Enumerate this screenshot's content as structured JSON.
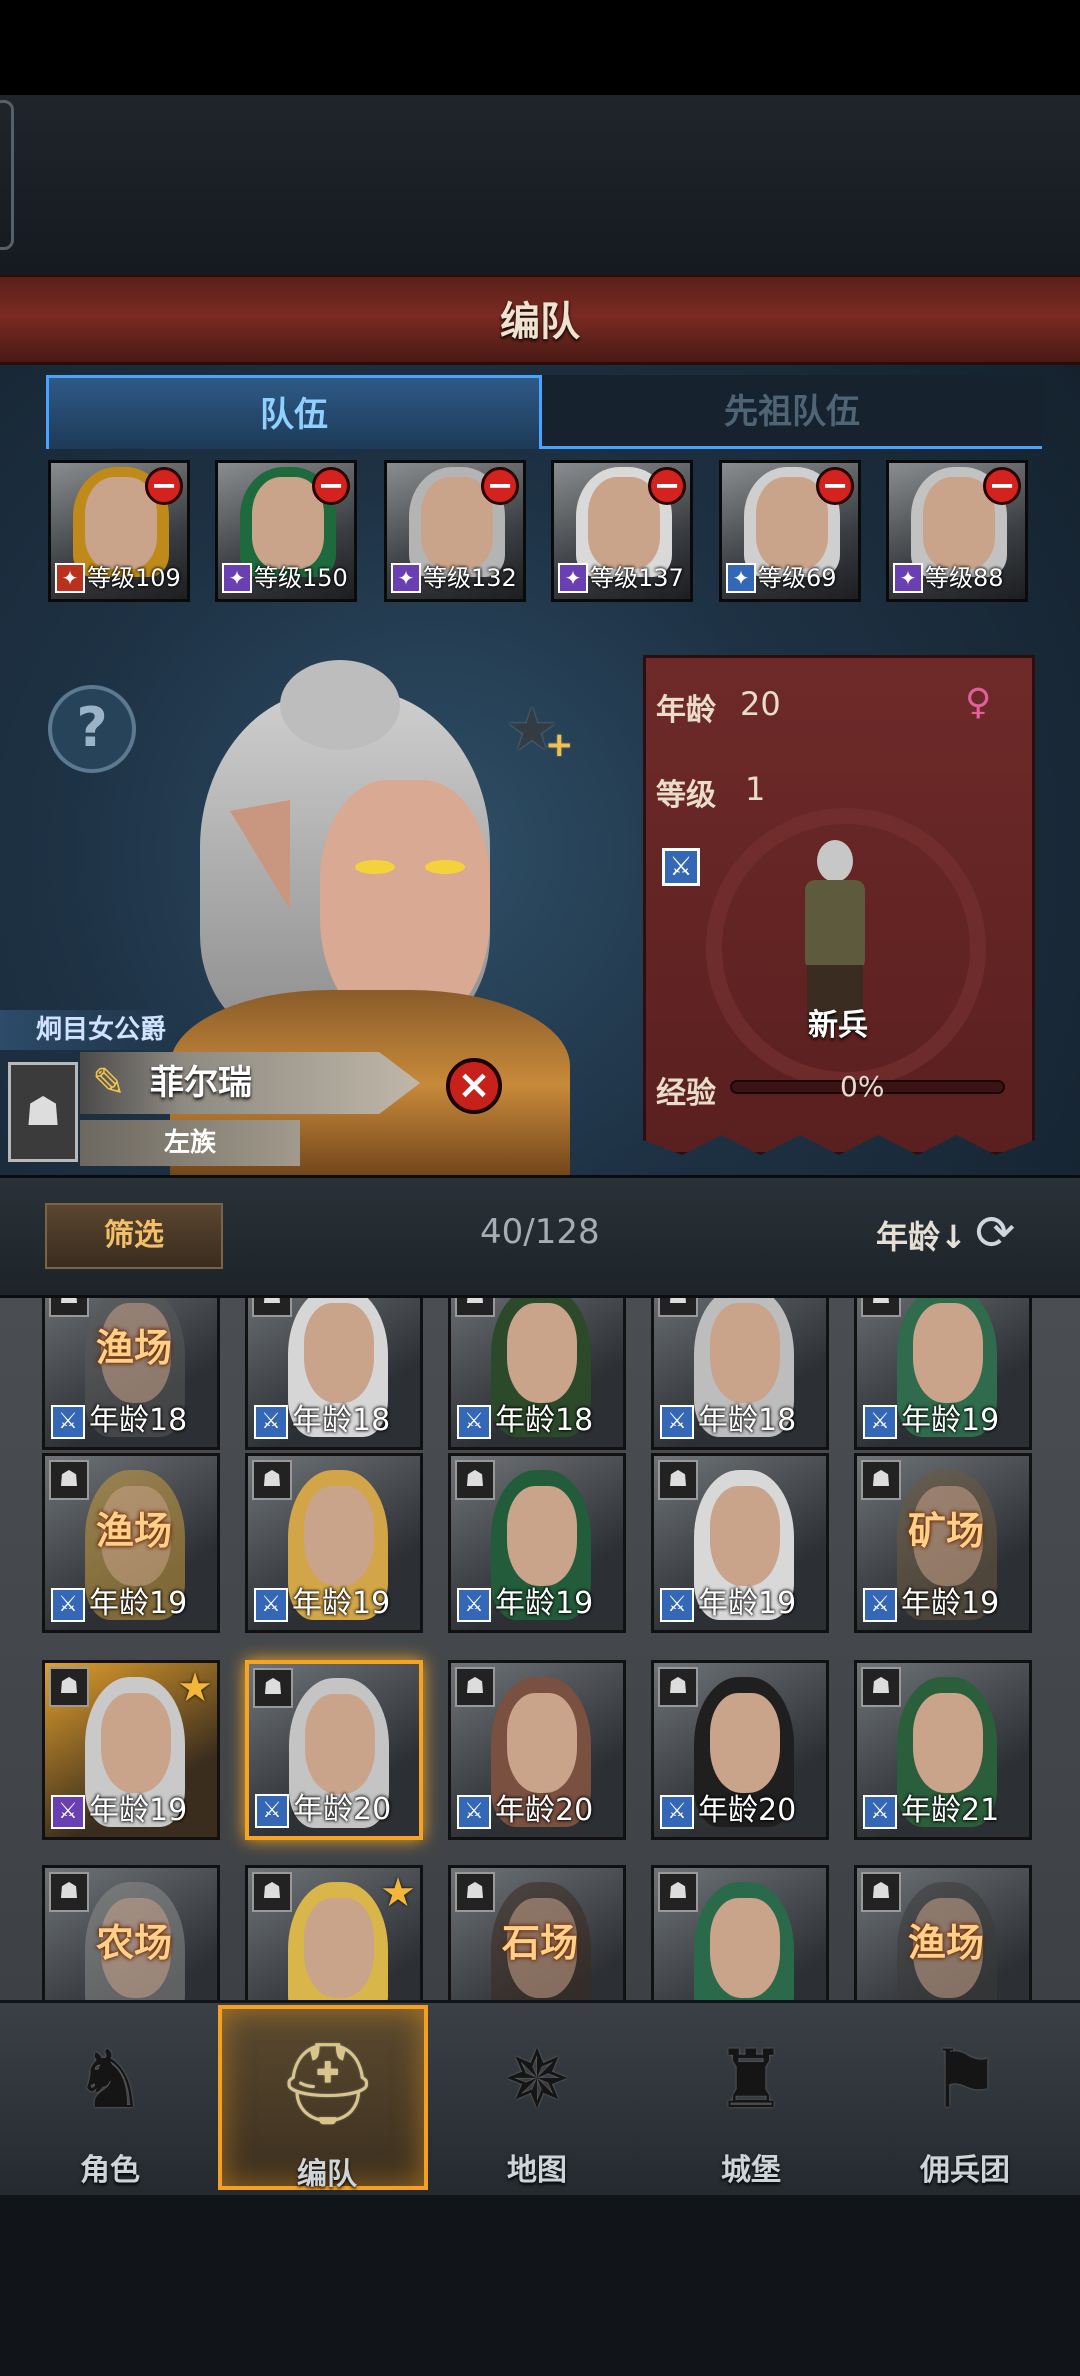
{
  "title": "编队",
  "tabs": {
    "team": "队伍",
    "ancestor": "先祖队伍"
  },
  "team_slots": [
    {
      "level": "等级109",
      "hair": "#c08a1a",
      "cls_color": "#b8321e"
    },
    {
      "level": "等级150",
      "hair": "#1f6a3c",
      "cls_color": "#6a3fb2"
    },
    {
      "level": "等级132",
      "hair": "#b4b4b4",
      "cls_color": "#6a3fb2"
    },
    {
      "level": "等级137",
      "hair": "#d9d9d9",
      "cls_color": "#6a3fb2"
    },
    {
      "level": "等级69",
      "hair": "#cfcfcf",
      "cls_color": "#3567b7"
    },
    {
      "level": "等级88",
      "hair": "#c2c2c2",
      "cls_color": "#6a3fb2"
    }
  ],
  "hero": {
    "title": "炯目女公爵",
    "name": "菲尔瑞",
    "tribe": "左族",
    "age_label": "年龄",
    "age": "20",
    "level_label": "等级",
    "level": "1",
    "unit": "新兵",
    "exp_label": "经验",
    "exp": "0%"
  },
  "filter": {
    "button": "筛选",
    "count": "40/128",
    "sort": "年龄↓"
  },
  "roster": [
    {
      "age": "年龄18",
      "job": "渔场",
      "hair": "#5a5a5a",
      "cls": "blue"
    },
    {
      "age": "年龄18",
      "job": "",
      "hair": "#d6d6d6",
      "cls": "blue"
    },
    {
      "age": "年龄18",
      "job": "",
      "hair": "#2c4a2a",
      "cls": "blue"
    },
    {
      "age": "年龄18",
      "job": "",
      "hair": "#bdbdbd",
      "cls": "blue"
    },
    {
      "age": "年龄19",
      "job": "",
      "hair": "#2f6b4c",
      "cls": "blue"
    },
    {
      "age": "年龄19",
      "job": "渔场",
      "hair": "#c69a3e",
      "cls": "blue"
    },
    {
      "age": "年龄19",
      "job": "",
      "hair": "#d2a548",
      "cls": "blue"
    },
    {
      "age": "年龄19",
      "job": "",
      "hair": "#235c3a",
      "cls": "blue"
    },
    {
      "age": "年龄19",
      "job": "",
      "hair": "#d8d8d8",
      "cls": "blue"
    },
    {
      "age": "年龄19",
      "job": "矿场",
      "hair": "#6b5a3f",
      "cls": "blue"
    },
    {
      "age": "年龄19",
      "job": "",
      "hair": "#c9c9c9",
      "cls": "purple",
      "star": true,
      "gold": true
    },
    {
      "age": "年龄20",
      "job": "",
      "hair": "#c4c4c4",
      "cls": "blue",
      "selected": true
    },
    {
      "age": "年龄20",
      "job": "",
      "hair": "#7a5040",
      "cls": "blue"
    },
    {
      "age": "年龄20",
      "job": "",
      "hair": "#1f1f1f",
      "cls": "blue"
    },
    {
      "age": "年龄21",
      "job": "",
      "hair": "#2b5e3a",
      "cls": "blue"
    },
    {
      "age": "",
      "job": "农场",
      "hair": "#8a8a8a",
      "cls": "none"
    },
    {
      "age": "",
      "job": "",
      "hair": "#d9b64a",
      "cls": "none",
      "star": true
    },
    {
      "age": "",
      "job": "石场",
      "hair": "#3a2a20",
      "cls": "none"
    },
    {
      "age": "",
      "job": "",
      "hair": "#2a6a4a",
      "cls": "none"
    },
    {
      "age": "",
      "job": "渔场",
      "hair": "#3a3a3a",
      "cls": "none"
    }
  ],
  "nav": [
    {
      "label": "角色",
      "icon": "knight-icon"
    },
    {
      "label": "编队",
      "icon": "helmet-icon"
    },
    {
      "label": "地图",
      "icon": "compass-map-icon"
    },
    {
      "label": "城堡",
      "icon": "castle-icon"
    },
    {
      "label": "佣兵团",
      "icon": "mercenary-icon"
    }
  ]
}
